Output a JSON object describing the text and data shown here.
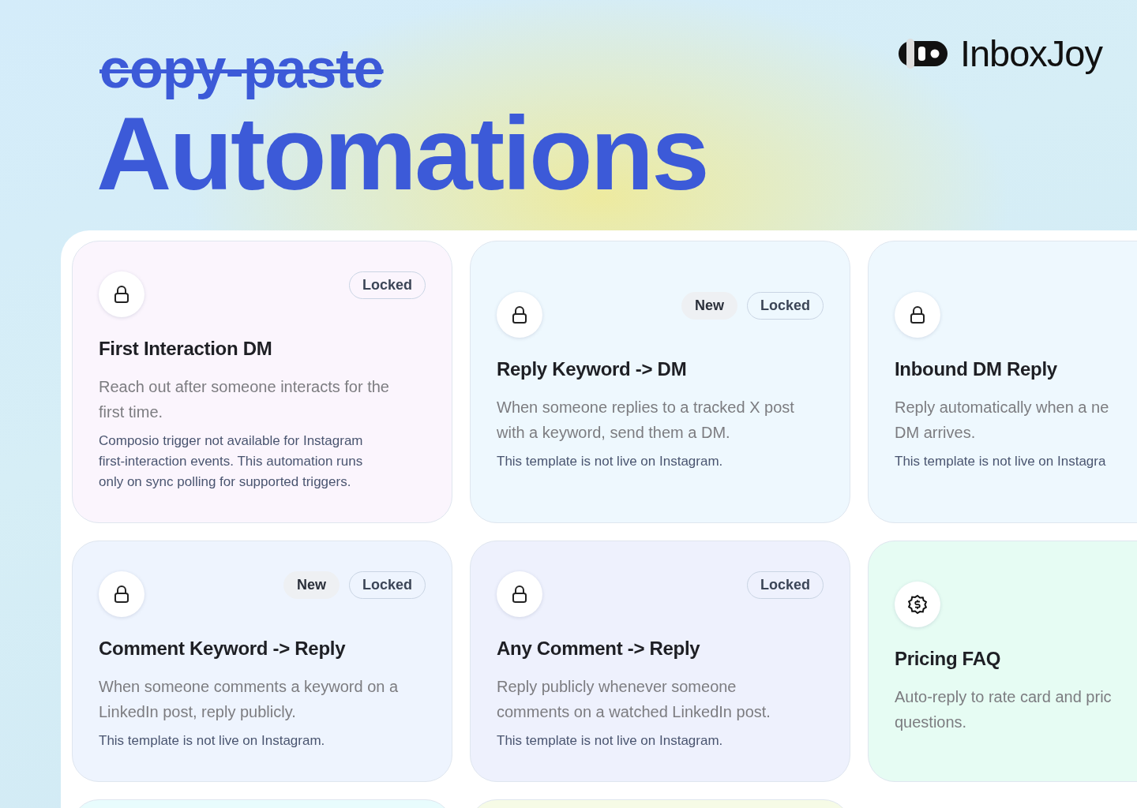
{
  "header": {
    "struck_word": "copy-paste",
    "title": "Automations",
    "logo": {
      "name": "InboxJoy"
    }
  },
  "cards": [
    {
      "color": "#fbf5fd",
      "kind": "locked",
      "badges": [
        {
          "kind": "locked",
          "label": "Locked"
        }
      ],
      "title": "First Interaction DM",
      "description": [
        "Reach out after someone interacts for the",
        "first time."
      ],
      "note": [
        "Composio trigger not available for Instagram",
        "first-interaction events. This automation runs",
        "only on sync polling for supported triggers."
      ]
    },
    {
      "color": "#eef8fe",
      "kind": "locked",
      "badges": [
        {
          "kind": "new",
          "label": "New"
        },
        {
          "kind": "locked",
          "label": "Locked"
        }
      ],
      "title": "Reply Keyword -> DM",
      "description": [
        "When someone replies to a tracked X post",
        "with a keyword, send them a DM."
      ],
      "note": [
        "This template is not live on Instagram."
      ]
    },
    {
      "color": "#eef8fe",
      "kind": "locked",
      "title": "Inbound DM Reply",
      "description": [
        "Reply automatically when a ne",
        "DM arrives."
      ],
      "note": [
        "This template is not live on Instagra"
      ]
    },
    {
      "color": "#eef4fe",
      "kind": "locked",
      "badges": [
        {
          "kind": "new",
          "label": "New"
        },
        {
          "kind": "locked",
          "label": "Locked"
        }
      ],
      "title": "Comment Keyword -> Reply",
      "description": [
        "When someone comments a keyword on a",
        "LinkedIn post, reply publicly."
      ],
      "note": [
        "This template is not live on Instagram."
      ]
    },
    {
      "color": "#eef1fd",
      "kind": "locked",
      "badges": [
        {
          "kind": "locked",
          "label": "Locked"
        }
      ],
      "title": "Any Comment -> Reply",
      "description": [
        "Reply publicly whenever someone",
        "comments on a watched LinkedIn post."
      ],
      "note": [
        "This template is not live on Instagram."
      ]
    },
    {
      "color": "#e6fcf3",
      "kind": "pricing",
      "title": "Pricing FAQ",
      "description": [
        "Auto-reply to rate card and pric",
        "questions."
      ]
    },
    {
      "color": "#e8fcfd"
    },
    {
      "color": "#f6fbe6"
    }
  ]
}
